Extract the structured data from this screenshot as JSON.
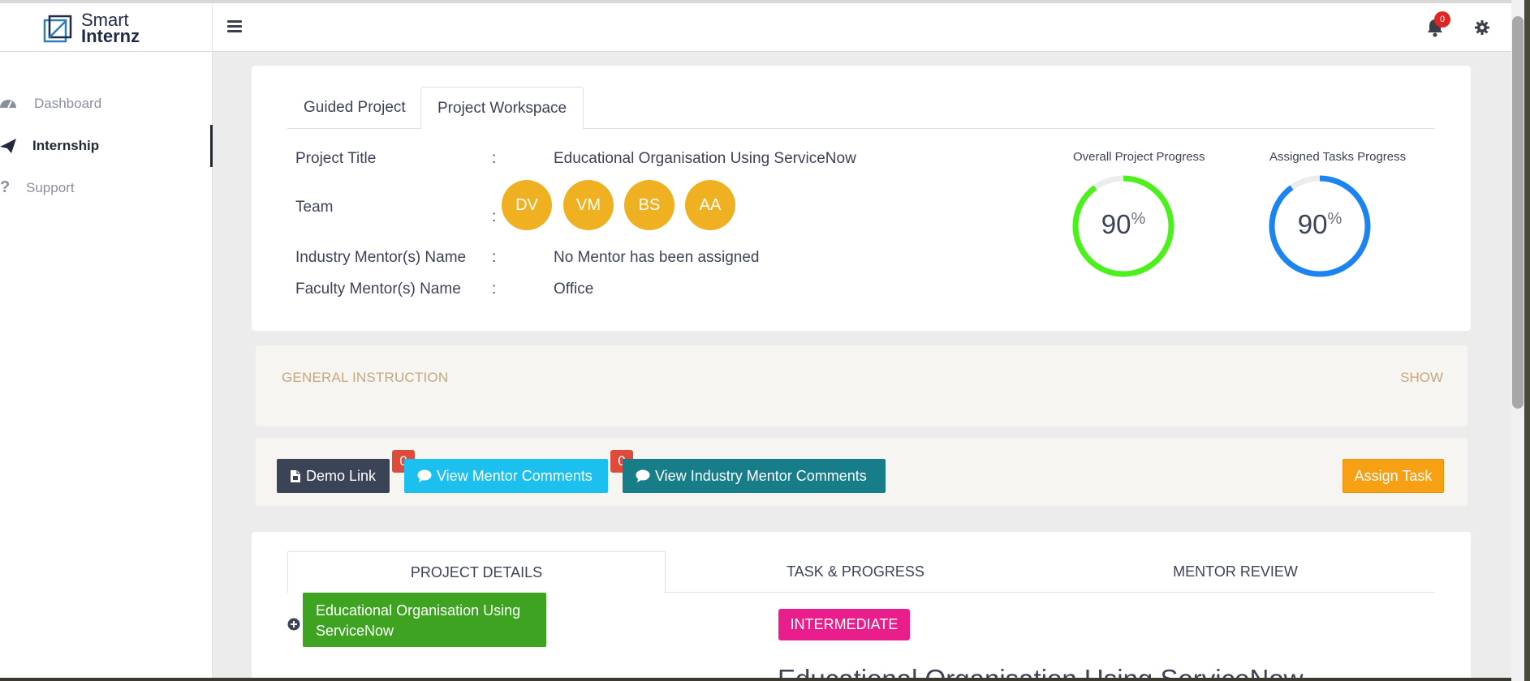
{
  "brand": {
    "line1": "Smart",
    "line2": "Internz"
  },
  "header": {
    "notification_count": "0"
  },
  "sidebar": {
    "items": [
      {
        "label": "Dashboard"
      },
      {
        "label": "Internship"
      },
      {
        "label": "Support"
      }
    ]
  },
  "tabs": [
    {
      "label": "Guided Project"
    },
    {
      "label": "Project Workspace"
    }
  ],
  "project": {
    "title_label": "Project Title",
    "title_value": "Educational Organisation Using ServiceNow",
    "team_label": "Team",
    "team": [
      "DV",
      "VM",
      "BS",
      "AA"
    ],
    "industry_mentor_label": "Industry Mentor(s) Name",
    "industry_mentor_value": "No Mentor has been assigned",
    "faculty_mentor_label": "Faculty Mentor(s) Name",
    "faculty_mentor_value": "Office",
    "colon": ":"
  },
  "progress": {
    "overall": {
      "title": "Overall Project Progress",
      "value": "90",
      "unit": "%",
      "fraction": 0.9,
      "color": "#4cf01a"
    },
    "assigned": {
      "title": "Assigned Tasks Progress",
      "value": "90",
      "unit": "%",
      "fraction": 0.9,
      "color": "#1c84f0"
    }
  },
  "instructions": {
    "title": "GENERAL INSTRUCTION",
    "toggle": "SHOW"
  },
  "actions": {
    "demo_link": "Demo Link",
    "mentor_comments": "View Mentor Comments",
    "mentor_comments_count": "0",
    "industry_comments": "View Industry Mentor Comments",
    "industry_comments_count": "0",
    "assign_task": "Assign Task"
  },
  "bottom_tabs": [
    {
      "label": "PROJECT DETAILS"
    },
    {
      "label": "TASK & PROGRESS"
    },
    {
      "label": "MENTOR REVIEW"
    }
  ],
  "details": {
    "project_chip": "Educational Organisation Using ServiceNow",
    "level": "INTERMEDIATE",
    "heading": "Educational Organisation Using ServiceNow"
  }
}
